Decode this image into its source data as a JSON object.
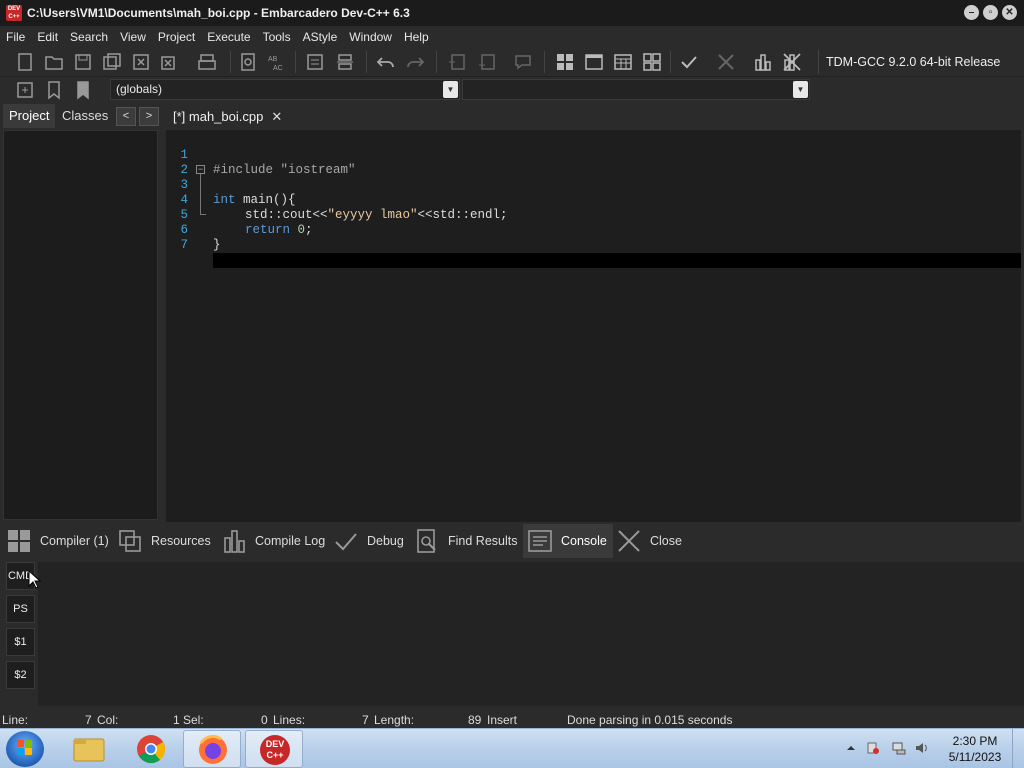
{
  "window": {
    "title": "C:\\Users\\VM1\\Documents\\mah_boi.cpp - Embarcadero Dev-C++ 6.3",
    "icon_text": "DEV C++"
  },
  "menu": [
    "File",
    "Edit",
    "Search",
    "View",
    "Project",
    "Execute",
    "Tools",
    "AStyle",
    "Window",
    "Help"
  ],
  "toolbar": {
    "compiler": "TDM-GCC 9.2.0 64-bit Release",
    "scope": "(globals)",
    "scope2": ""
  },
  "left_panel": {
    "tabs": [
      "Project",
      "Classes"
    ],
    "nav_prev": "<",
    "nav_next": ">"
  },
  "editor": {
    "tab_label": "[*] mah_boi.cpp",
    "line_numbers": [
      "1",
      "2",
      "3",
      "4",
      "5",
      "6",
      "7"
    ],
    "lines": {
      "l1": "#include \"iostream\"",
      "l3_kw": "int",
      "l3_rest": " main(){",
      "l4_a": "std::cout<<",
      "l4_str": "\"eyyyy lmao\"",
      "l4_b": "<<std::endl;",
      "l5_kw": "return",
      "l5_num": "0",
      "l5_end": ";",
      "l6": "}"
    }
  },
  "bottom_tabs": [
    "Compiler (1)",
    "Resources",
    "Compile Log",
    "Debug",
    "Find Results",
    "Console",
    "Close"
  ],
  "console_buttons": [
    "CMD",
    "PS",
    "$1",
    "$2"
  ],
  "status": {
    "line_label": "Line:",
    "line_val": "7",
    "col_label": "Col:",
    "col_val": "1",
    "sel_label": "Sel:",
    "sel_val": "0",
    "lines_label": "Lines:",
    "lines_val": "7",
    "length_label": "Length:",
    "length_val": "89",
    "mode": "Insert",
    "message": "Done parsing in 0.015 seconds"
  },
  "taskbar": {
    "time": "2:30 PM",
    "date": "5/11/2023",
    "devcpp_label": "DEV C++"
  },
  "colors": {
    "accent": "#3fa8d8",
    "keyword": "#5a9ad6",
    "string": "#e8c8a0"
  }
}
